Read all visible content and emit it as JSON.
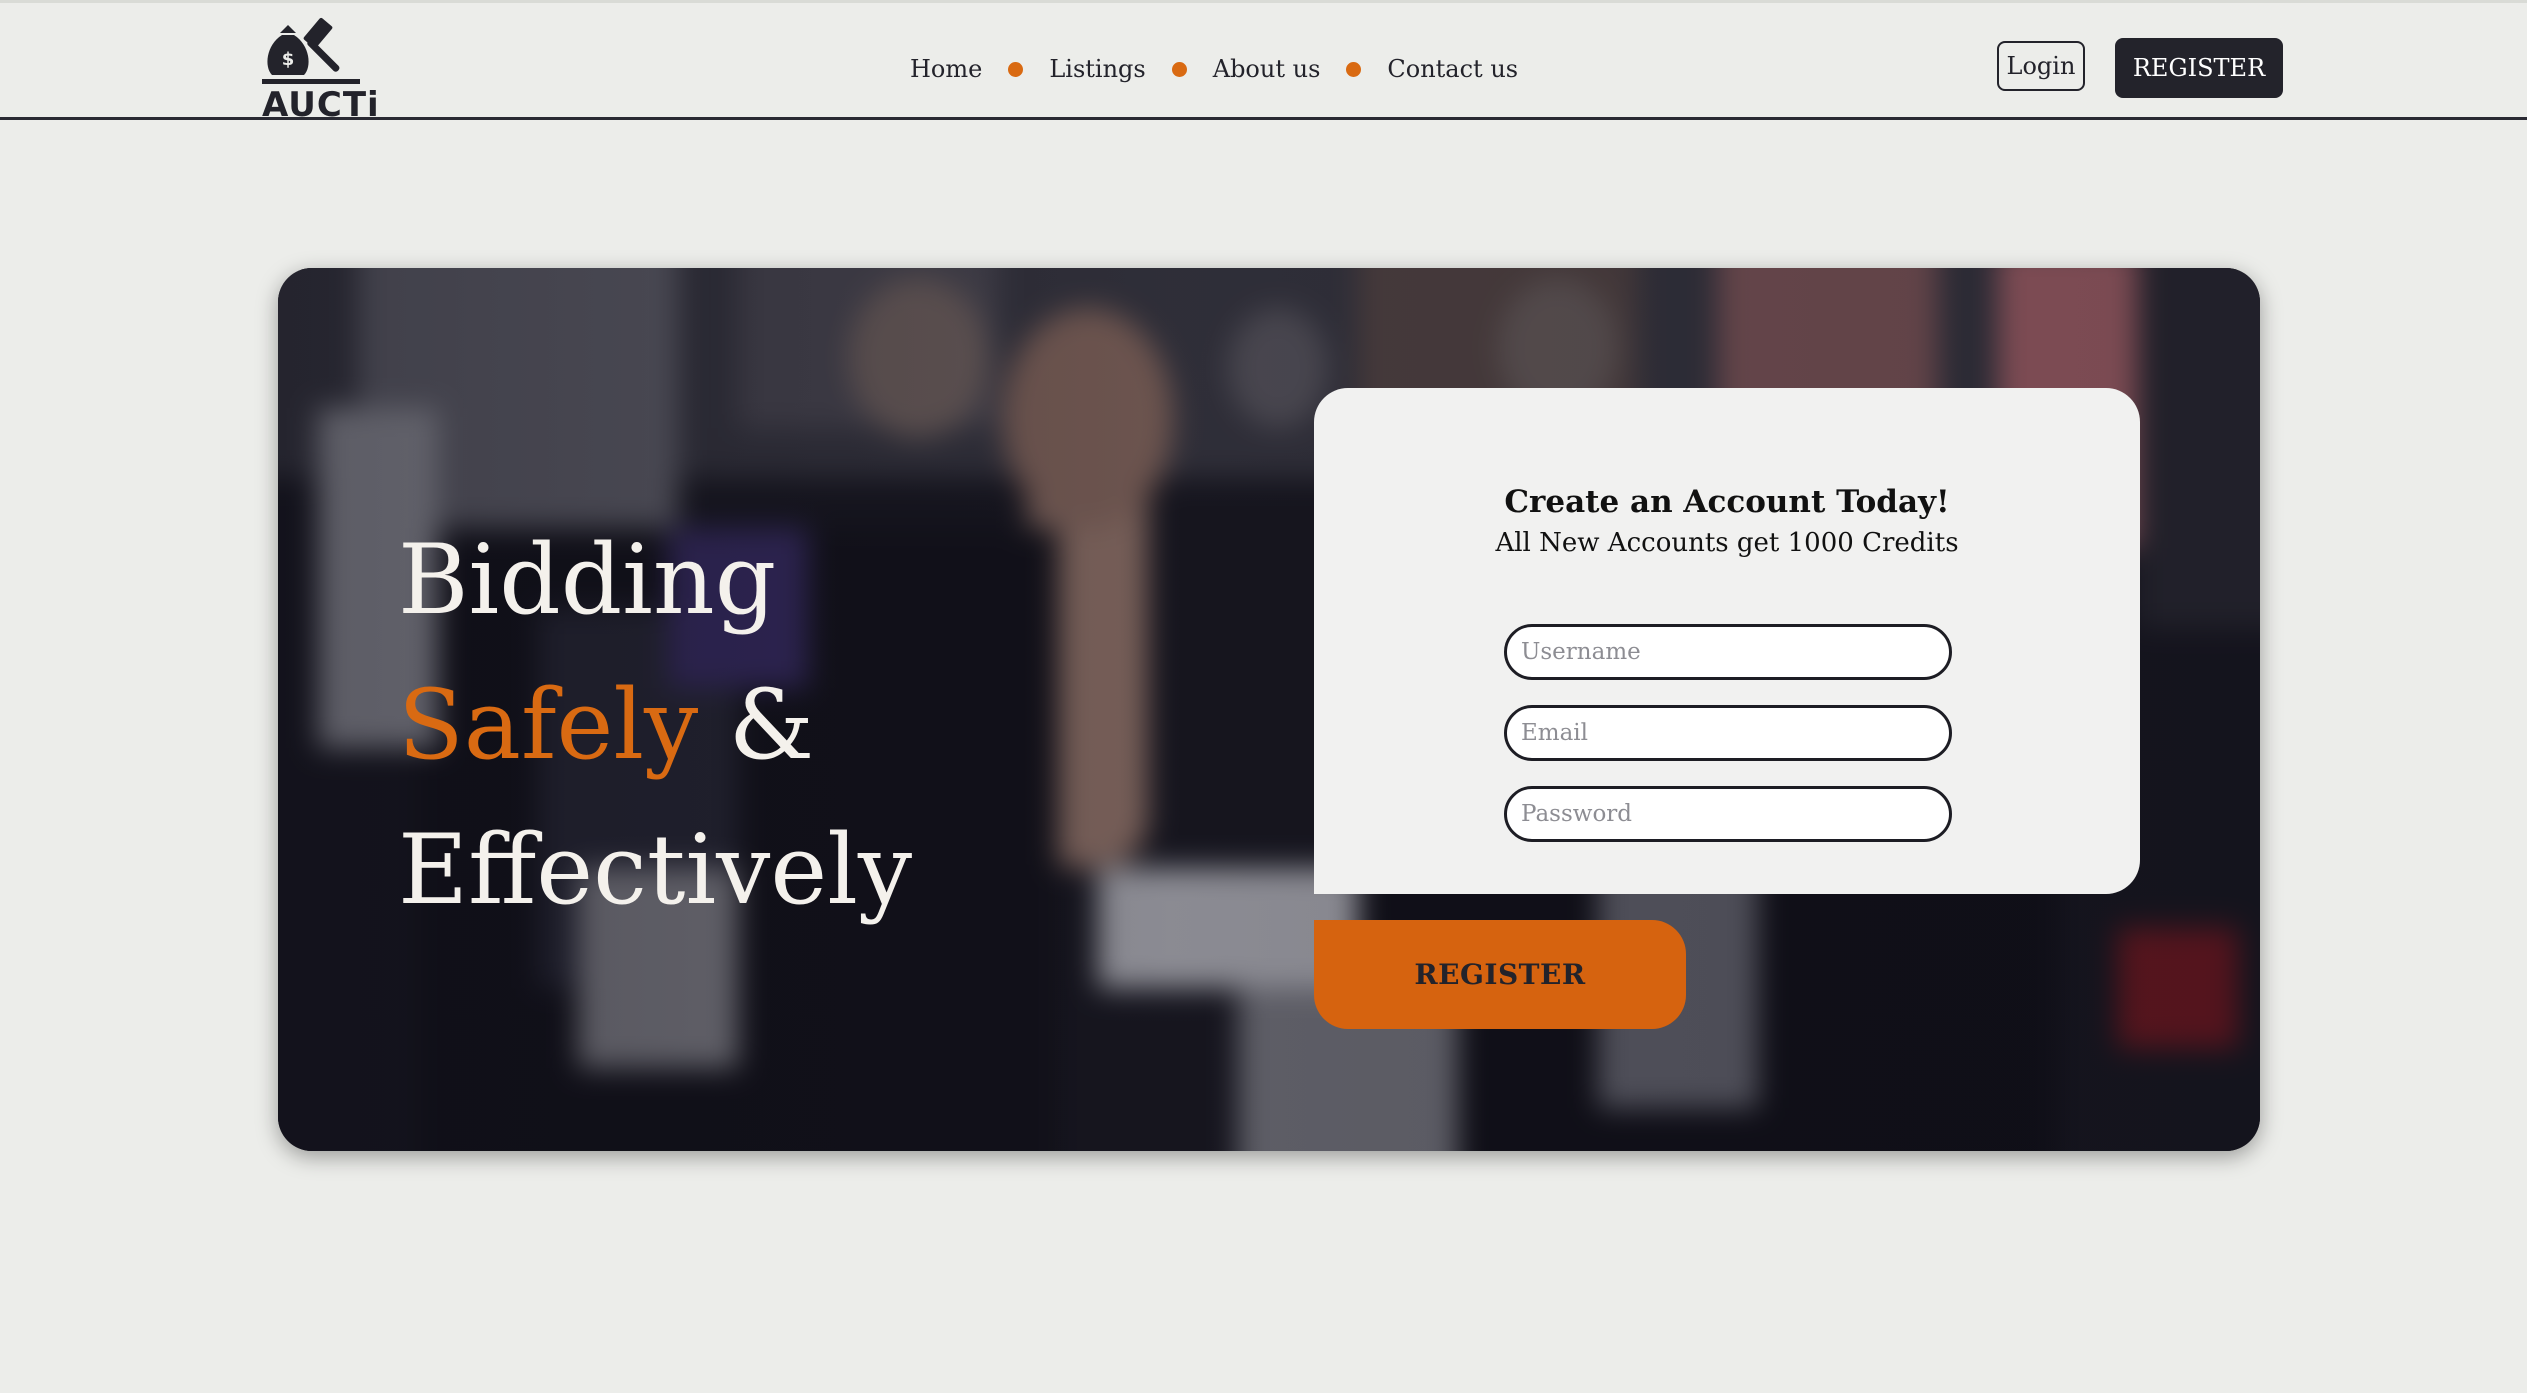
{
  "brand": {
    "logo_text": "AUCTi",
    "logo_icon": "gavel-money-bag-icon"
  },
  "nav": {
    "items": [
      {
        "label": "Home"
      },
      {
        "label": "Listings"
      },
      {
        "label": "About us"
      },
      {
        "label": "Contact us"
      }
    ]
  },
  "header": {
    "login_label": "Login",
    "register_label": "REGISTER"
  },
  "hero": {
    "line1": "Bidding",
    "line2_accent": "Safely",
    "line2_rest": " &",
    "line3": "Effectively"
  },
  "signup": {
    "title": "Create an Account Today!",
    "subtitle": "All New Accounts get 1000 Credits",
    "username_placeholder": "Username",
    "email_placeholder": "Email",
    "password_placeholder": "Password",
    "submit_label": "REGISTER"
  },
  "colors": {
    "accent": "#d96a12",
    "dark": "#23232b",
    "background": "#ecedea"
  }
}
